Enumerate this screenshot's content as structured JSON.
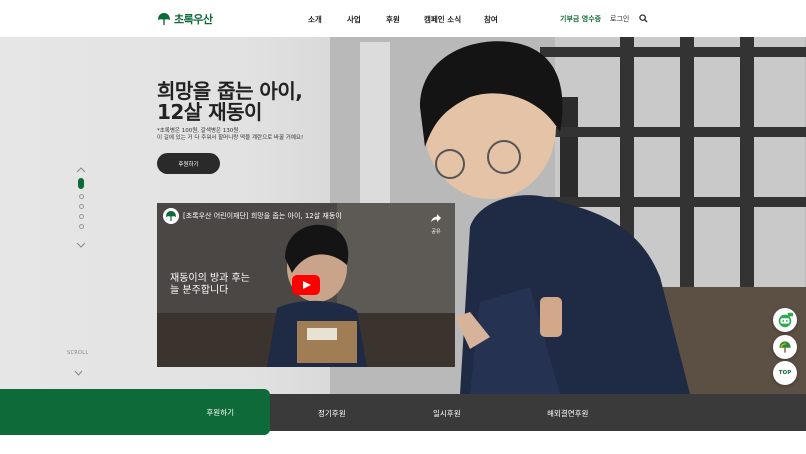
{
  "header": {
    "logo_text": "초록우산",
    "nav": [
      "소개",
      "사업",
      "후원",
      "캠페인 소식",
      "참여"
    ],
    "receipt_label": "기부금 영수증",
    "login_label": "로그인"
  },
  "hero": {
    "title_line1": "희망을 줍는 아이,",
    "title_line2": "12살 재동이",
    "desc_line1": "*초록병은 100원, 갈색병은 130원.",
    "desc_line2": "이 길에 있는 거 다 주워서 할머니랑 떡을 계란으로 바꿀 거예요!",
    "donate_button": "후원하기",
    "scroll_label": "SCROLL"
  },
  "video": {
    "title": "[초록우산 어린이재단] 희망을 줍는 아이, 12살 재동이",
    "share_label": "공유",
    "caption_line1": "재동이의 방과 후는",
    "caption_line2": "늘 분주합니다"
  },
  "floating": {
    "top_label": "TOP"
  },
  "bottom_tabs": {
    "active": "후원하기",
    "tabs": [
      "정기후원",
      "일시후원",
      "해외결연후원"
    ]
  },
  "colors": {
    "brand_green": "#0f6a3a",
    "bottom_bar": "#3a3a3a",
    "play_red": "#ff0000"
  }
}
